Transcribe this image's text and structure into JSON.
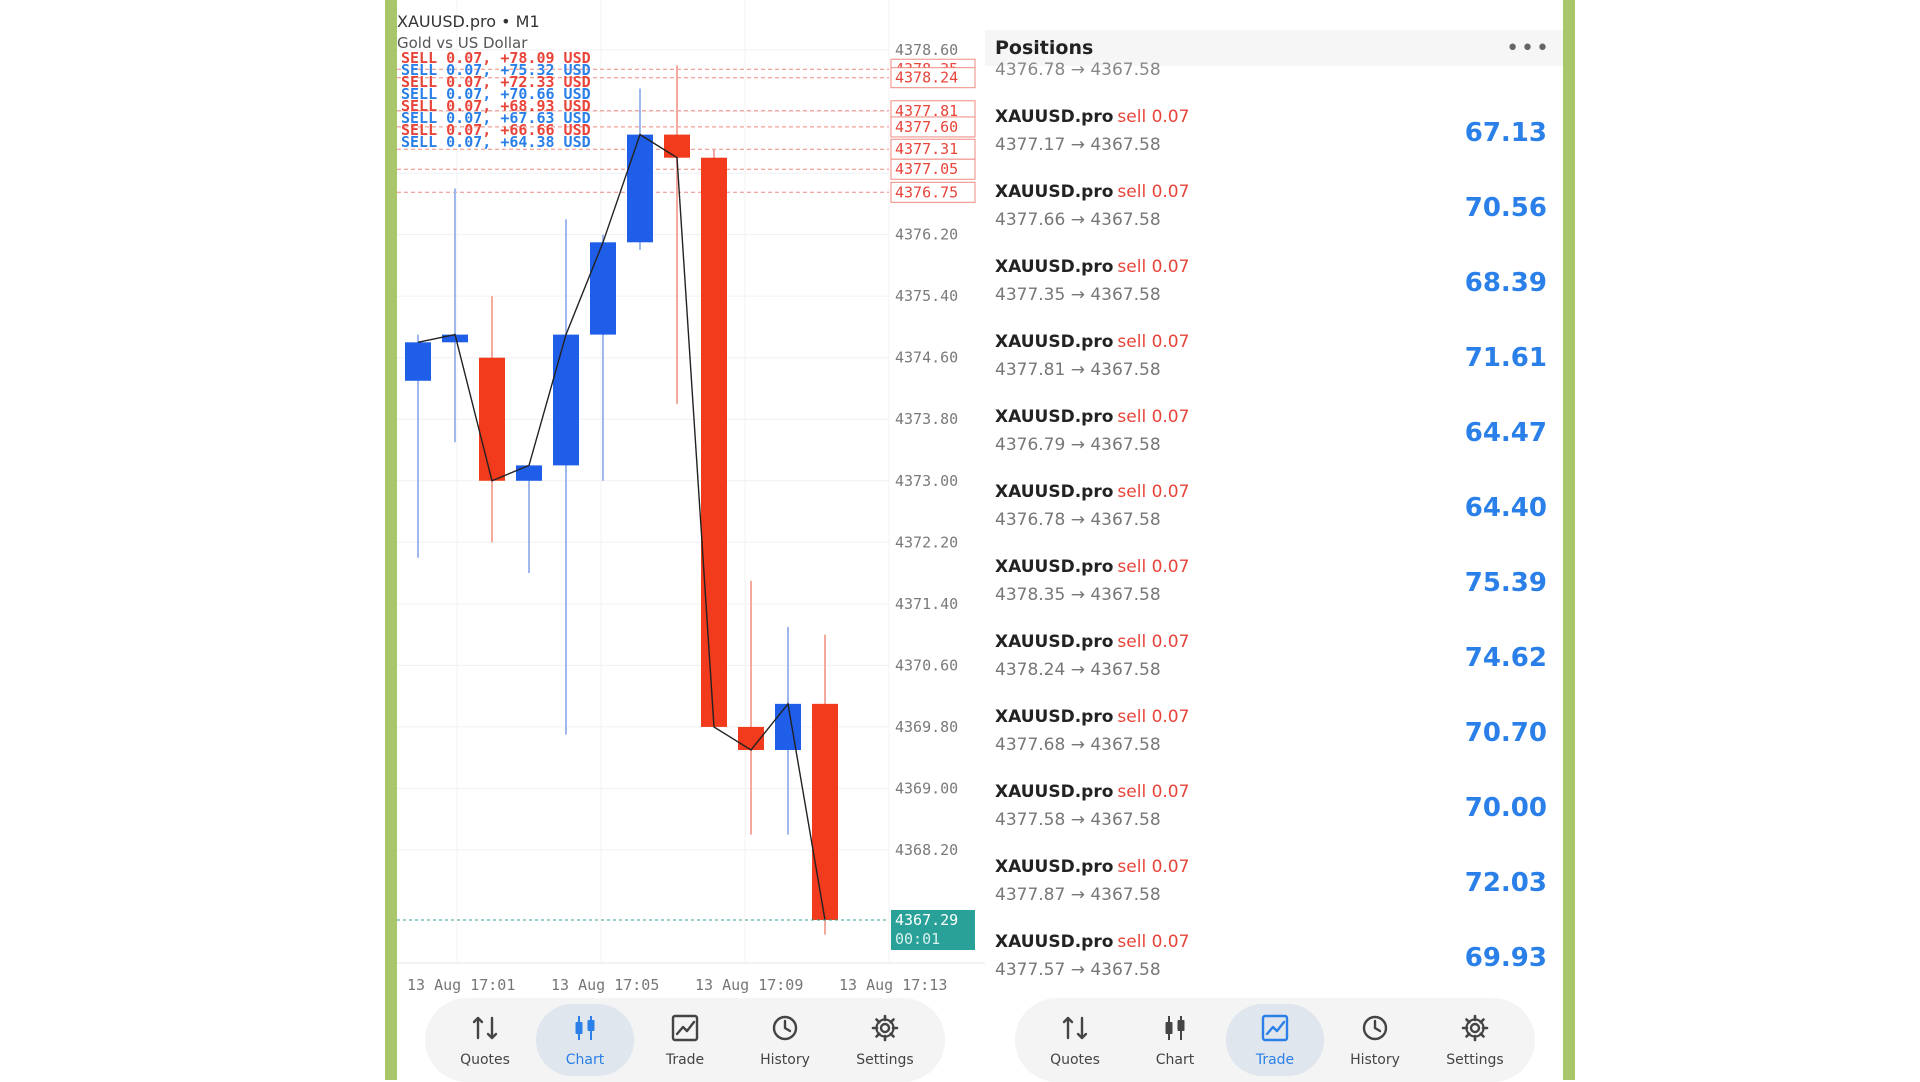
{
  "chart": {
    "symbol": "XAUUSD.pro • M1",
    "description": "Gold vs US Dollar",
    "price_axis": [
      "4378.60",
      "4377.80",
      "4377.00",
      "4376.20",
      "4375.40",
      "4374.60",
      "4373.80",
      "4373.00",
      "4372.20",
      "4371.40",
      "4370.60",
      "4369.80",
      "4369.00",
      "4368.20"
    ],
    "position_tags": [
      "4378.35",
      "4378.24",
      "4377.81",
      "4377.60",
      "4377.31",
      "4377.05",
      "4376.75"
    ],
    "position_line_labels": [
      {
        "text": "SELL 0.07, +78.09 USD",
        "color": "#e8443a"
      },
      {
        "text": "SELL 0.07, +75.32 USD",
        "color": "#2a80e8"
      },
      {
        "text": "SELL 0.07, +72.33 USD",
        "color": "#e8443a"
      },
      {
        "text": "SELL 0.07, +70.66 USD",
        "color": "#2a80e8"
      },
      {
        "text": "SELL 0.07, +68.93 USD",
        "color": "#e8443a"
      },
      {
        "text": "SELL 0.07, +67.63 USD",
        "color": "#2a80e8"
      },
      {
        "text": "SELL 0.07, +66.66 USD",
        "color": "#e8443a"
      },
      {
        "text": "SELL 0.07, +64.38 USD",
        "color": "#2a80e8"
      }
    ],
    "current_price": "4367.29",
    "countdown": "00:01",
    "time_axis": [
      "13 Aug 17:01",
      "13 Aug 17:05",
      "13 Aug 17:09",
      "13 Aug 17:13"
    ],
    "colors": {
      "bull": "#1f5ee8",
      "bear": "#f23a1c",
      "current": "#2aa198"
    }
  },
  "chart_data": {
    "type": "candlestick",
    "candles": [
      {
        "o": 4374.3,
        "h": 4374.9,
        "l": 4372.0,
        "c": 4374.8
      },
      {
        "o": 4374.8,
        "h": 4376.8,
        "l": 4373.5,
        "c": 4374.9
      },
      {
        "o": 4374.6,
        "h": 4375.4,
        "l": 4372.2,
        "c": 4373.0
      },
      {
        "o": 4373.0,
        "h": 4373.1,
        "l": 4371.8,
        "c": 4373.2
      },
      {
        "o": 4373.2,
        "h": 4376.4,
        "l": 4369.7,
        "c": 4374.9
      },
      {
        "o": 4374.9,
        "h": 4376.2,
        "l": 4373.0,
        "c": 4376.1
      },
      {
        "o": 4376.1,
        "h": 4378.1,
        "l": 4376.0,
        "c": 4377.5
      },
      {
        "o": 4377.5,
        "h": 4378.4,
        "l": 4374.0,
        "c": 4377.2
      },
      {
        "o": 4377.2,
        "h": 4377.3,
        "l": 4369.8,
        "c": 4369.8
      },
      {
        "o": 4369.8,
        "h": 4371.7,
        "l": 4368.4,
        "c": 4369.5
      },
      {
        "o": 4369.5,
        "h": 4371.1,
        "l": 4368.4,
        "c": 4370.1
      },
      {
        "o": 4370.1,
        "h": 4371.0,
        "l": 4367.1,
        "c": 4367.29
      }
    ]
  },
  "positions": {
    "title": "Positions",
    "more_label": "•••",
    "partial_row": "4376.78 → 4367.58",
    "items": [
      {
        "symbol": "XAUUSD.pro",
        "side": "sell 0.07",
        "prices": "4377.17 → 4367.58",
        "profit": "67.13"
      },
      {
        "symbol": "XAUUSD.pro",
        "side": "sell 0.07",
        "prices": "4377.66 → 4367.58",
        "profit": "70.56"
      },
      {
        "symbol": "XAUUSD.pro",
        "side": "sell 0.07",
        "prices": "4377.35 → 4367.58",
        "profit": "68.39"
      },
      {
        "symbol": "XAUUSD.pro",
        "side": "sell 0.07",
        "prices": "4377.81 → 4367.58",
        "profit": "71.61"
      },
      {
        "symbol": "XAUUSD.pro",
        "side": "sell 0.07",
        "prices": "4376.79 → 4367.58",
        "profit": "64.47"
      },
      {
        "symbol": "XAUUSD.pro",
        "side": "sell 0.07",
        "prices": "4376.78 → 4367.58",
        "profit": "64.40"
      },
      {
        "symbol": "XAUUSD.pro",
        "side": "sell 0.07",
        "prices": "4378.35 → 4367.58",
        "profit": "75.39"
      },
      {
        "symbol": "XAUUSD.pro",
        "side": "sell 0.07",
        "prices": "4378.24 → 4367.58",
        "profit": "74.62"
      },
      {
        "symbol": "XAUUSD.pro",
        "side": "sell 0.07",
        "prices": "4377.68 → 4367.58",
        "profit": "70.70"
      },
      {
        "symbol": "XAUUSD.pro",
        "side": "sell 0.07",
        "prices": "4377.58 → 4367.58",
        "profit": "70.00"
      },
      {
        "symbol": "XAUUSD.pro",
        "side": "sell 0.07",
        "prices": "4377.87 → 4367.58",
        "profit": "72.03"
      },
      {
        "symbol": "XAUUSD.pro",
        "side": "sell 0.07",
        "prices": "4377.57 → 4367.58",
        "profit": "69.93"
      }
    ]
  },
  "nav_left": {
    "active": "chart",
    "items": [
      {
        "id": "quotes",
        "label": "Quotes",
        "icon": "quotes-icon"
      },
      {
        "id": "chart",
        "label": "Chart",
        "icon": "chart-icon"
      },
      {
        "id": "trade",
        "label": "Trade",
        "icon": "trade-icon"
      },
      {
        "id": "history",
        "label": "History",
        "icon": "history-icon"
      },
      {
        "id": "settings",
        "label": "Settings",
        "icon": "settings-icon"
      }
    ]
  },
  "nav_right": {
    "active": "trade",
    "items": [
      {
        "id": "quotes",
        "label": "Quotes",
        "icon": "quotes-icon"
      },
      {
        "id": "chart",
        "label": "Chart",
        "icon": "chart-icon"
      },
      {
        "id": "trade",
        "label": "Trade",
        "icon": "trade-icon"
      },
      {
        "id": "history",
        "label": "History",
        "icon": "history-icon"
      },
      {
        "id": "settings",
        "label": "Settings",
        "icon": "settings-icon"
      }
    ]
  }
}
